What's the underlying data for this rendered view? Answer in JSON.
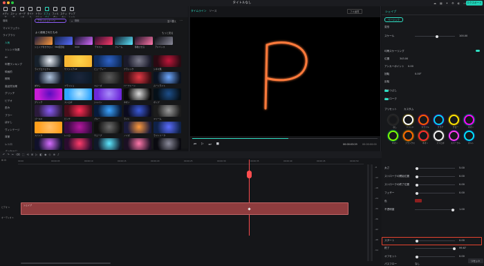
{
  "window": {
    "title": "タイトルなし",
    "export_label": "エクスポート"
  },
  "colors": {
    "accent": "#2fe0c4",
    "highlight": "#e8432f",
    "clip": "#8e3c3e",
    "playhead": "#ff4d4f",
    "glow": "#ff7a3a"
  },
  "toolbar": {
    "items": [
      "メディア",
      "ストック",
      "オーディオ",
      "タイトル",
      "トランジション",
      "エフェクト",
      "フィルター",
      "ステッカー",
      "テンプレート"
    ]
  },
  "sidebar": {
    "items": [
      "強化",
      "マイエフェクト",
      "ライブラリ",
      "人気",
      "トレンド効果",
      "AI",
      "年間ランキング",
      "映画的",
      "照明",
      "高品質効果",
      "グリッチ",
      "ビデオ",
      "歪み",
      "ブラー",
      "ぼかし",
      "ヴィンテージ",
      "背景",
      "レトロ",
      "パッケージ"
    ]
  },
  "library": {
    "tag_button": "ブラッシュトーン",
    "search_placeholder": "検索",
    "sort_label": "並べ替え",
    "section_title": "よく使用されたもの",
    "more_label": "もっと見る",
    "row1": [
      "シェイプ付きクロップ",
      "360度回転",
      "UI/UI",
      "テキスト",
      "フレーム",
      "移動させる",
      "アドバンス"
    ],
    "captions": [
      "ライブエフェクト",
      "サファイアUP",
      "ビューティー",
      "クラシック",
      "シネマ風",
      "ぼかし",
      "フラッシュ",
      "スムーズ",
      "ハーフトーン",
      "ムーンライト",
      "グリッチ",
      "ストロボ",
      "シャイン",
      "ネオン",
      "ポップ",
      "ゴールド",
      "ピンク",
      "ブルー",
      "ライト",
      "ドリーム",
      "スパイク",
      "レトロ",
      "ウェーブ",
      "ノイズ",
      "ライトリーク",
      "ミラー",
      "パーティクル",
      "カラフル"
    ]
  },
  "preview": {
    "tab_active": "タイムライン",
    "tab_other": "ソース",
    "quality": "フル品質",
    "time_current": "00:00:03:29",
    "time_total": "00:00:00:00"
  },
  "timeline": {
    "ruler_marks": [
      "00:00",
      "00:00:05",
      "00:00:10",
      "00:00:15",
      "00:00:20",
      "00:00:25",
      "00:00:30",
      "00:00:35",
      "00:00:40",
      "00:00:45",
      "00:00:50"
    ],
    "track1": "ビデオ 1",
    "track2": "オーディオ 1",
    "clip_label": "シェイプ"
  },
  "meter": {
    "ticks": [
      "-6",
      "-12",
      "-18",
      "-24",
      "-30",
      "-36",
      "-42",
      "-48",
      "-54"
    ]
  },
  "right_panel": {
    "tab": "シェイプ",
    "sub_tab": "ベーシック",
    "transform": "変形",
    "scale": "スケール",
    "scale_val": "100.00",
    "position_label": "位置",
    "position_x": "343.00",
    "position_y": "0.00",
    "anchor": "アンカーポイント",
    "anchor_x": "0.00",
    "anchor_y": "0.00",
    "rotate": "回転",
    "rotate_val": "0.00°",
    "flip": "反転",
    "uniform_scale": "均等スケーリング",
    "fill": "塗りつぶし",
    "stroke": "ストローク",
    "stroke_type": "ストローク",
    "presets": "プリセット",
    "custom": "カスタム",
    "swatch_names": [
      "なし",
      "ソリッド",
      "カラフル",
      "グラデ",
      "グロー",
      "ネオン",
      "ネオン",
      "フラックス",
      "ネオン",
      "ストロボ",
      "スパークル",
      "ボルト"
    ],
    "width": "太さ",
    "width_val": "5.00",
    "glow_start": "ストロークの開始位置",
    "glow_start_val": "0.00",
    "glow_end": "ストロークの終了位置",
    "glow_end_val": "0.00",
    "feather": "フェザー",
    "feather_val": "0.00",
    "color": "色",
    "opacity": "不透明度",
    "opacity_val": "1.00",
    "gradient": "グラデーション",
    "start": "スタート",
    "start_val": "0.00",
    "end": "終了",
    "end_val": "99.67",
    "offset": "オフセット",
    "offset_val": "0.00",
    "pos_type": "パスフロー",
    "pos_type_val": "なし",
    "ok": "リセット",
    "ok2": "OK"
  }
}
